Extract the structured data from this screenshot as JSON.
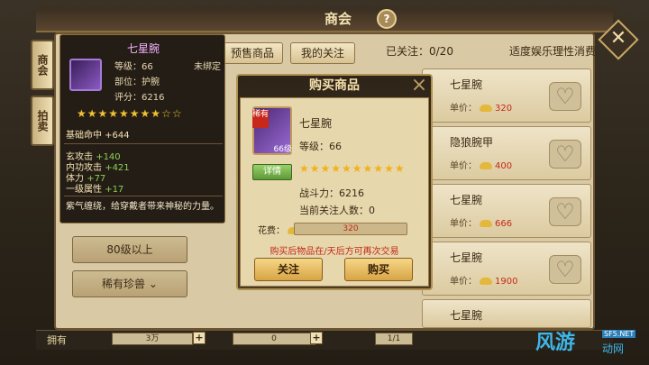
{
  "header": {
    "title": "商会",
    "help": "?"
  },
  "side_tabs": [
    "商会",
    "拍卖"
  ],
  "tabs": {
    "presale": "预售商品",
    "focus": "我的关注"
  },
  "follow_info": "已关注：0/20",
  "tip": "适度娱乐理性消费",
  "categories": {
    "level80": "80级以上",
    "rare_beast": "稀有珍兽"
  },
  "tooltip": {
    "name": "七星腕",
    "level": "等级：66",
    "bind": "未绑定",
    "part": "部位：护腕",
    "score": "评分：6216",
    "stars": "★★★★★★★★☆☆",
    "base": "基础命中 +644",
    "attrs": [
      {
        "label": "玄攻击",
        "value": "+140"
      },
      {
        "label": "内功攻击",
        "value": "+421"
      },
      {
        "label": "体力",
        "value": "+77"
      },
      {
        "label": "一级属性",
        "value": "+17"
      }
    ],
    "desc": "紫气缠绕，给穿戴者带来神秘的力量。"
  },
  "items": [
    {
      "name": "七星腕",
      "price_label": "单价：",
      "price": "320"
    },
    {
      "name": "隐狼腕甲",
      "price_label": "单价：",
      "price": "400"
    },
    {
      "name": "七星腕",
      "price_label": "单价：",
      "price": "666"
    },
    {
      "name": "七星腕",
      "price_label": "单价：",
      "price": "1900"
    },
    {
      "name": "七星腕",
      "price_label": "",
      "price": ""
    }
  ],
  "modal": {
    "title": "购买商品",
    "close": "×",
    "rare_tag": "稀有",
    "lv_tag": "66级",
    "detail_btn": "详情",
    "name": "七星腕",
    "level": "等级：66",
    "stars": "★★★★★★★★★★",
    "power_label": "战斗力：",
    "power": "6216",
    "fans": "当前关注人数：0",
    "cost_label": "花费：",
    "cost": "320",
    "warn": "购买后物品在/天后方可再次交易",
    "follow_btn": "关注",
    "buy_btn": "购买"
  },
  "bottom": {
    "own_label": "拥有",
    "own_value": "3万",
    "own2_value": "0",
    "page": "1/1"
  },
  "watermark": {
    "main": "风游",
    "site": "SF5.NET",
    "sub": "动网"
  }
}
